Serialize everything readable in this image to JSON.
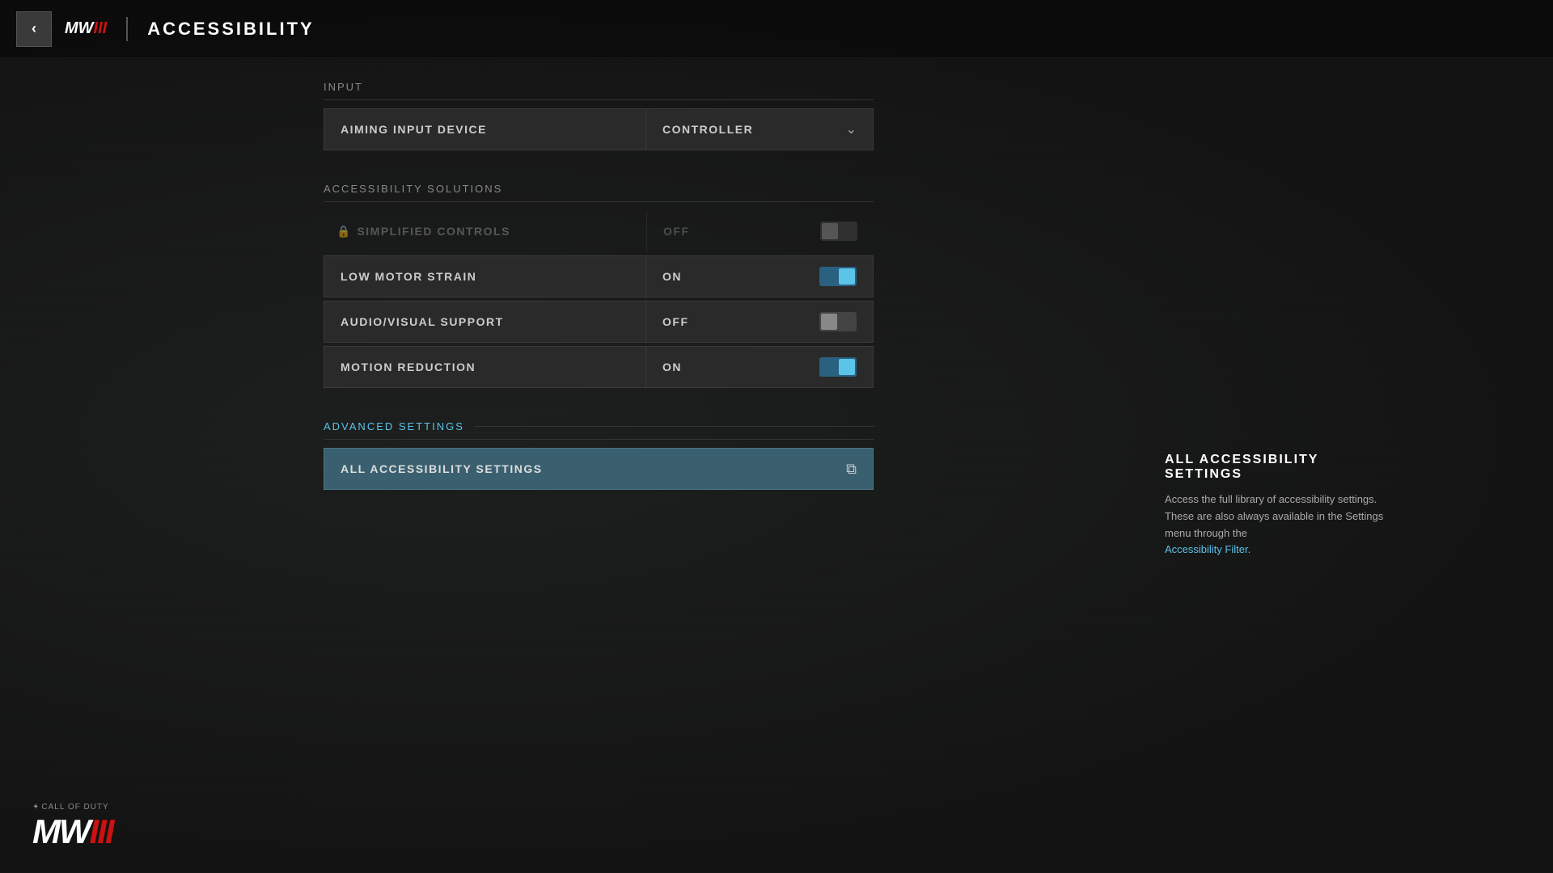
{
  "header": {
    "back_label": "←",
    "logo_mw": "MW",
    "logo_iii": "III",
    "title": "ACCESSIBILITY"
  },
  "input_section": {
    "label": "INPUT",
    "rows": [
      {
        "name": "AIMING INPUT DEVICE",
        "value": "CONTROLLER",
        "type": "dropdown"
      }
    ]
  },
  "accessibility_section": {
    "label": "ACCESSIBILITY SOLUTIONS",
    "simplified_controls": {
      "name": "SIMPLIFIED CONTROLS",
      "value": "OFF",
      "locked": true
    },
    "rows": [
      {
        "name": "LOW MOTOR STRAIN",
        "value": "ON",
        "toggle_state": "on"
      },
      {
        "name": "AUDIO/VISUAL SUPPORT",
        "value": "OFF",
        "toggle_state": "off"
      },
      {
        "name": "MOTION REDUCTION",
        "value": "ON",
        "toggle_state": "on"
      }
    ]
  },
  "advanced_section": {
    "label": "ADVANCED SETTINGS",
    "rows": [
      {
        "name": "ALL ACCESSIBILITY SETTINGS",
        "type": "external-link"
      }
    ]
  },
  "tooltip": {
    "title": "ALL ACCESSIBILITY SETTINGS",
    "body": "Access the full library of accessibility settings. These are also always available in the Settings menu through the",
    "link_text": "Accessibility Filter",
    "body_suffix": "."
  },
  "bottom_logo": {
    "cod_label": "CALL OF DUTY",
    "mw_text": "MW",
    "iii_text": "III"
  }
}
